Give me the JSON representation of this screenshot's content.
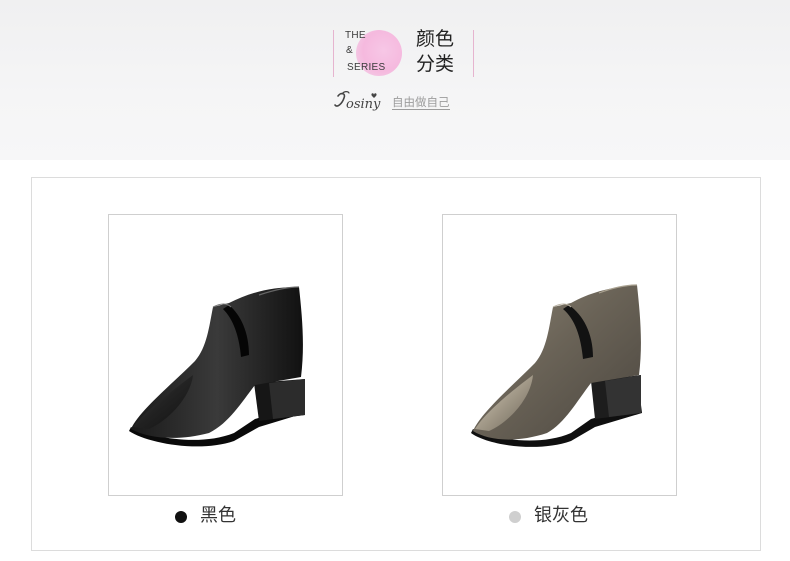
{
  "header": {
    "en_line1": "THE",
    "en_line2": "&",
    "en_line3": "SERIES",
    "cn_line1": "颜色",
    "cn_line2": "分类",
    "brand_logo_text": "Josiny",
    "slogan": "自由做自己"
  },
  "colors": {
    "accent_pink": "#f5b9de",
    "divider_pink": "#e6b4cf"
  },
  "products": [
    {
      "label": "黑色",
      "swatch_color": "#111111"
    },
    {
      "label": "银灰色",
      "swatch_color": "#cfcfcf"
    }
  ]
}
